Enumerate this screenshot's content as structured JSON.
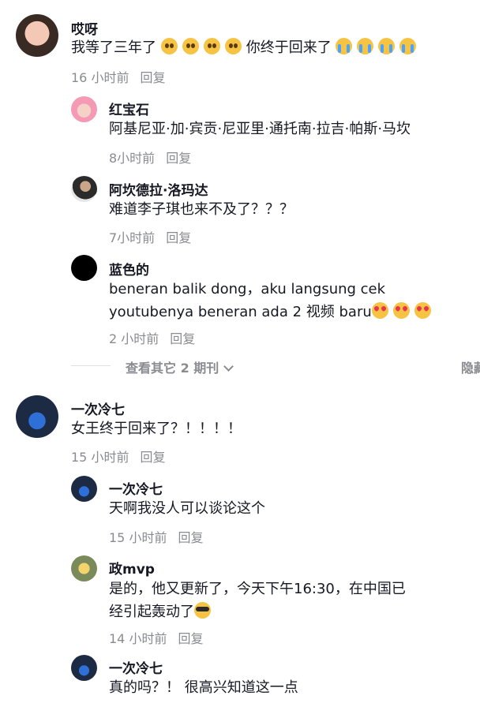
{
  "comments": [
    {
      "user": "哎呀",
      "text": "我等了三年了",
      "text2": "你终于回来了",
      "time": "16 小时前",
      "reply": "回复",
      "replies": [
        {
          "user": "红宝石",
          "text": "阿基尼亚·加·宾贡·尼亚里·通托南·拉吉·帕斯·马坎",
          "time": "8小时前",
          "reply": "回复"
        },
        {
          "user": "阿坎德拉·洛玛达",
          "text": "难道李子琪也来不及了？？？",
          "time": "7小时前",
          "reply": "回复"
        },
        {
          "user": "蓝色的",
          "text": "beneran balik dong，aku langsung cek",
          "text2": "youtubenya beneran ada 2 视频 baru",
          "time": "2 小时前",
          "reply": "回复"
        }
      ],
      "more_label": "查看其它 2 期刊",
      "hide_label": "隐藏"
    },
    {
      "user": "一次冷七",
      "text": "女王终于回来了？！！！！",
      "time": "15 小时前",
      "reply": "回复",
      "replies": [
        {
          "user": "一次冷七",
          "text": "天啊我没人可以谈论这个",
          "time": "15 小时前",
          "reply": "回复"
        },
        {
          "user": "政mvp",
          "text": "是的，他又更新了，今天下午16:30，在中国已",
          "text2": "经引起轰动了",
          "time": "14 小时前",
          "reply": "回复"
        },
        {
          "user": "一次冷七",
          "text": "真的吗？！  很高兴知道这一点"
        }
      ]
    }
  ],
  "colors": {
    "meta": "#8a8b91",
    "text": "#161823"
  }
}
